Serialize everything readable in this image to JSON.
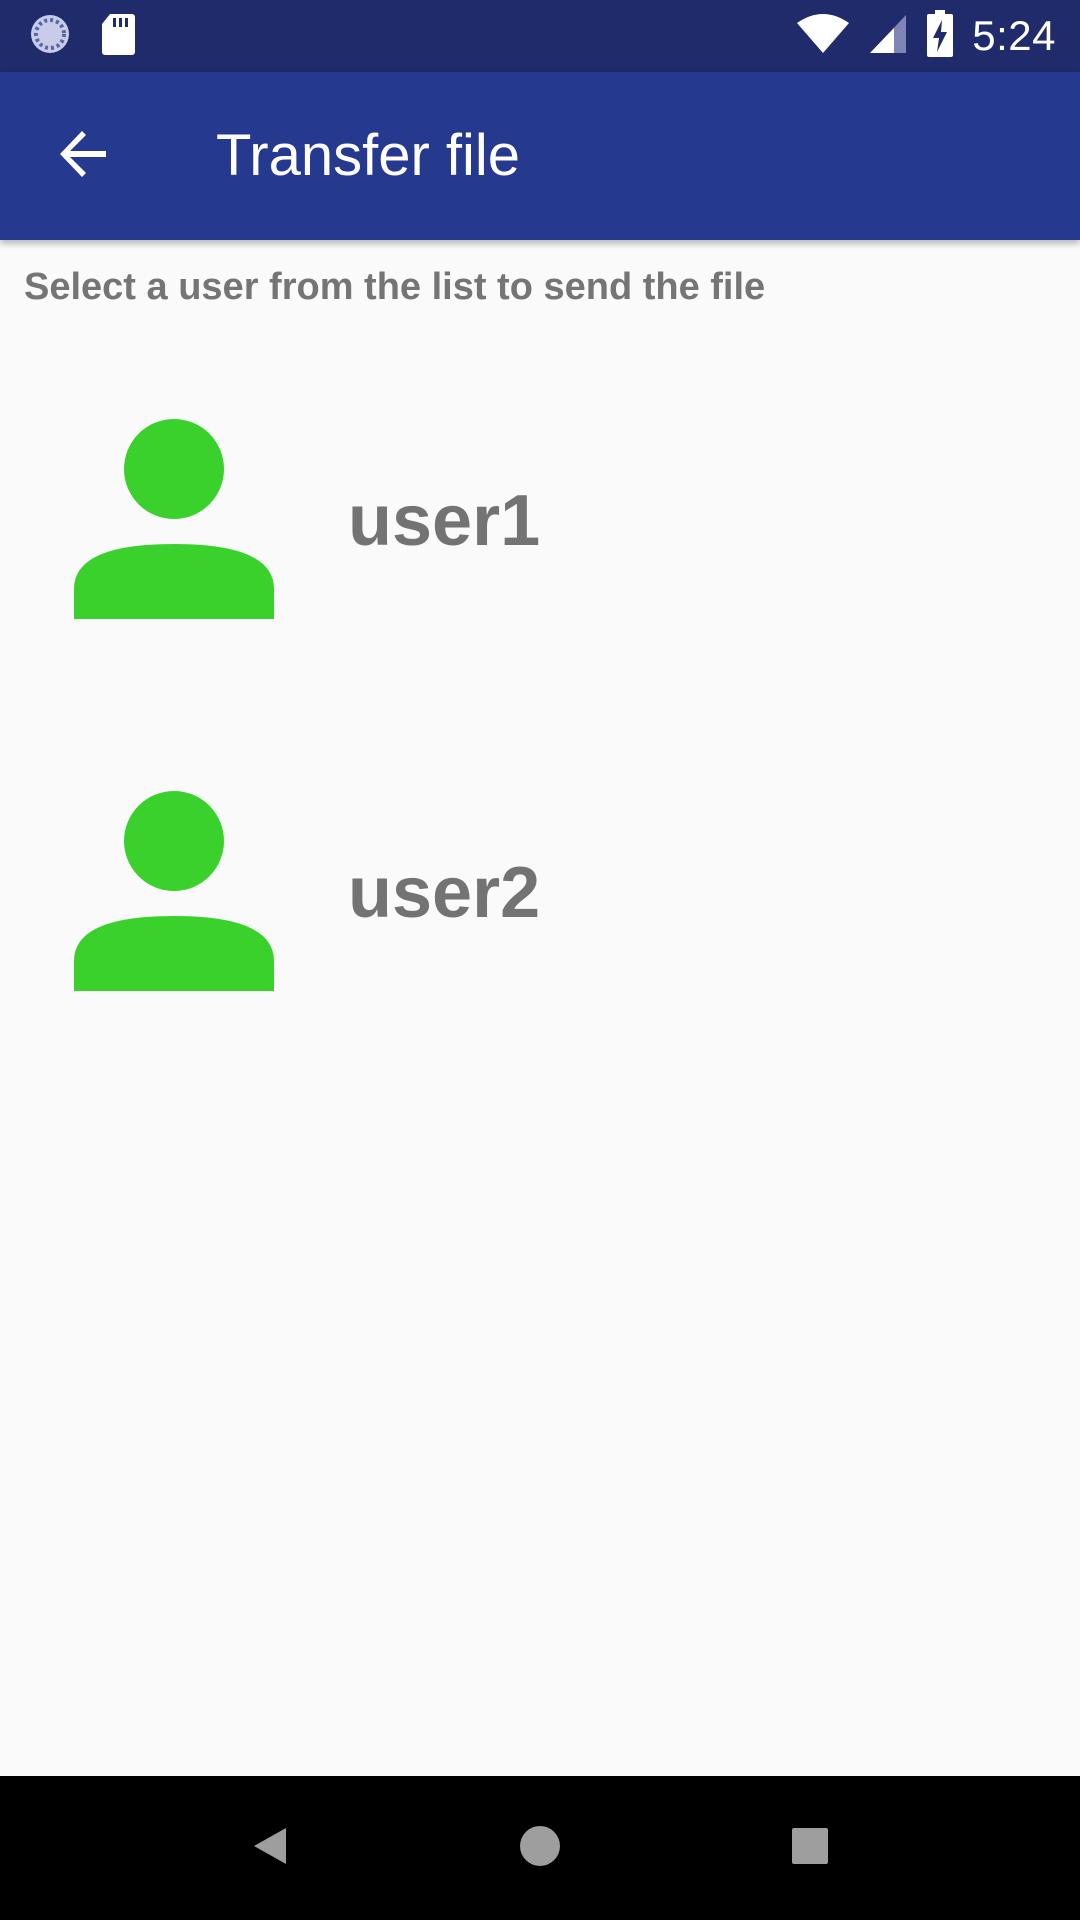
{
  "status_bar": {
    "time": "5:24",
    "icons": [
      "sync-icon",
      "sd-card-icon",
      "wifi-icon",
      "signal-icon",
      "battery-charging-icon"
    ]
  },
  "app_bar": {
    "title": "Transfer file",
    "back_icon": "arrow-back-icon",
    "color": "#25398e"
  },
  "instructions": "Select a user from the list to send the file",
  "users": [
    {
      "name": "user1",
      "avatar_icon": "person-icon",
      "avatar_color": "#3ad12d"
    },
    {
      "name": "user2",
      "avatar_icon": "person-icon",
      "avatar_color": "#3ad12d"
    }
  ],
  "nav_bar": {
    "icons": [
      "nav-back-icon",
      "nav-home-icon",
      "nav-recents-icon"
    ]
  }
}
